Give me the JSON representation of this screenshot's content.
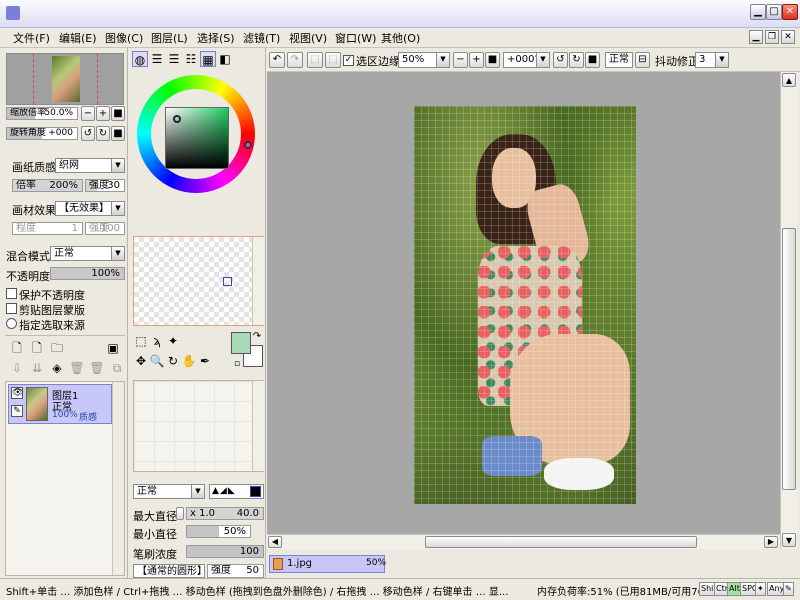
{
  "window": {
    "minimize_icon": "minimize-icon",
    "maximize_icon": "maximize-icon",
    "close_icon": "close-icon"
  },
  "menu": {
    "items": [
      "文件(F)",
      "编辑(E)",
      "图像(C)",
      "图层(L)",
      "选择(S)",
      "滤镜(T)",
      "视图(V)",
      "窗口(W)",
      "其他(O)"
    ]
  },
  "navigator": {
    "zoom_label": "缩放倍率",
    "zoom_value": "50.0%",
    "rotate_label": "旋转角度",
    "rotate_value": "+000"
  },
  "paper": {
    "texture_label": "画纸质感",
    "texture_value": "织网",
    "scale_label": "倍率",
    "scale_value": "200%",
    "strength_label": "强度",
    "strength_value": "30",
    "effect_label": "画材效果",
    "effect_value": "【无效果】",
    "degree_label": "程度",
    "degree_value": "1",
    "effect_strength_label": "强度",
    "effect_strength_value": "100"
  },
  "layer_props": {
    "blend_label": "混合模式",
    "blend_value": "正常",
    "opacity_label": "不透明度",
    "opacity_value": "100%",
    "opacity_fraction": 1.0,
    "protect_opacity": "保护不透明度",
    "clip_layer": "剪贴图层蒙版",
    "selection_source": "指定选取来源"
  },
  "layers": [
    {
      "name": "图层1",
      "mode": "正常",
      "opacity": "100%",
      "extra": "质感"
    }
  ],
  "brush": {
    "mode_value": "正常",
    "max_size_label": "最大直径",
    "max_size_mult": "x 1.0",
    "max_size_value": "40.0",
    "min_size_label": "最小直径",
    "min_size_value": "50%",
    "min_size_fraction": 0.5,
    "density_label": "笔刷浓度",
    "density_value": "100",
    "density_fraction": 1.0,
    "tip_value": "【通常的圆形】",
    "tip_strength_label": "强度",
    "tip_strength_value": "50"
  },
  "toolbar": {
    "selection_edge_label": "选区边缘",
    "zoom_value": "50%",
    "rotate_value": "+000°",
    "mode_value": "正常",
    "stabilizer_label": "抖动修正",
    "stabilizer_value": "3"
  },
  "document_tab": {
    "name": "1.jpg",
    "zoom": "50%"
  },
  "status": {
    "hint": "Shift+单击 … 添加色样 / Ctrl+拖拽 … 移动色样 (拖拽到色盘外删除色) / 右拖拽 … 移动色样 / 右键单击 … 显...",
    "memory": "内存负荷率:51% (已用81MB/可用767MB)",
    "keys": [
      "Shift",
      "Ctrl",
      "Alt",
      "SPC",
      "Any"
    ]
  },
  "colors": {
    "accent": "#c8c8f8",
    "primary_swatch": "#a8d8b8",
    "secondary_swatch": "#ffffff",
    "layer_selected": "#c8c8f8"
  }
}
